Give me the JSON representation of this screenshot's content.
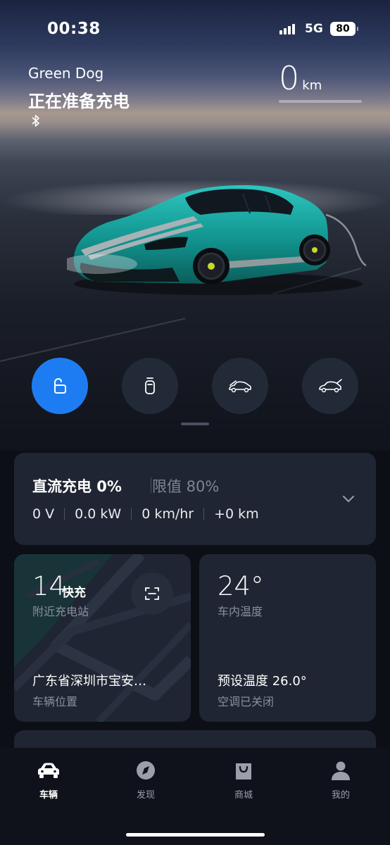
{
  "status_bar": {
    "time": "00:38",
    "network": "5G",
    "battery": "80"
  },
  "vehicle": {
    "name": "Green Dog",
    "status": "正在准备充电",
    "range_value": "0",
    "range_unit": "km"
  },
  "controls": [
    {
      "icon": "unlock-icon",
      "active": true
    },
    {
      "icon": "key-fob-icon",
      "active": false
    },
    {
      "icon": "frunk-icon",
      "active": false
    },
    {
      "icon": "trunk-icon",
      "active": false
    }
  ],
  "charging": {
    "title": "直流充电 0%",
    "limit": "限值 80%",
    "voltage": "0 V",
    "power": "0.0 kW",
    "rate": "0 km/hr",
    "added": "+0 km"
  },
  "stations": {
    "count": "14",
    "type": "快充",
    "label": "附近充电站",
    "location": "广东省深圳市宝安…",
    "location_label": "车辆位置"
  },
  "climate": {
    "temp": "24°",
    "temp_label": "车内温度",
    "preset": "预设温度 26.0°",
    "ac_status": "空调已关闭"
  },
  "tabs": [
    {
      "label": "车辆",
      "icon": "car-icon",
      "active": true
    },
    {
      "label": "发现",
      "icon": "compass-icon",
      "active": false
    },
    {
      "label": "商城",
      "icon": "shopping-bag-icon",
      "active": false
    },
    {
      "label": "我的",
      "icon": "profile-icon",
      "active": false
    }
  ],
  "colors": {
    "accent": "#1e7cf2",
    "card": "#1f2532",
    "car_body": "#17a3a0"
  }
}
